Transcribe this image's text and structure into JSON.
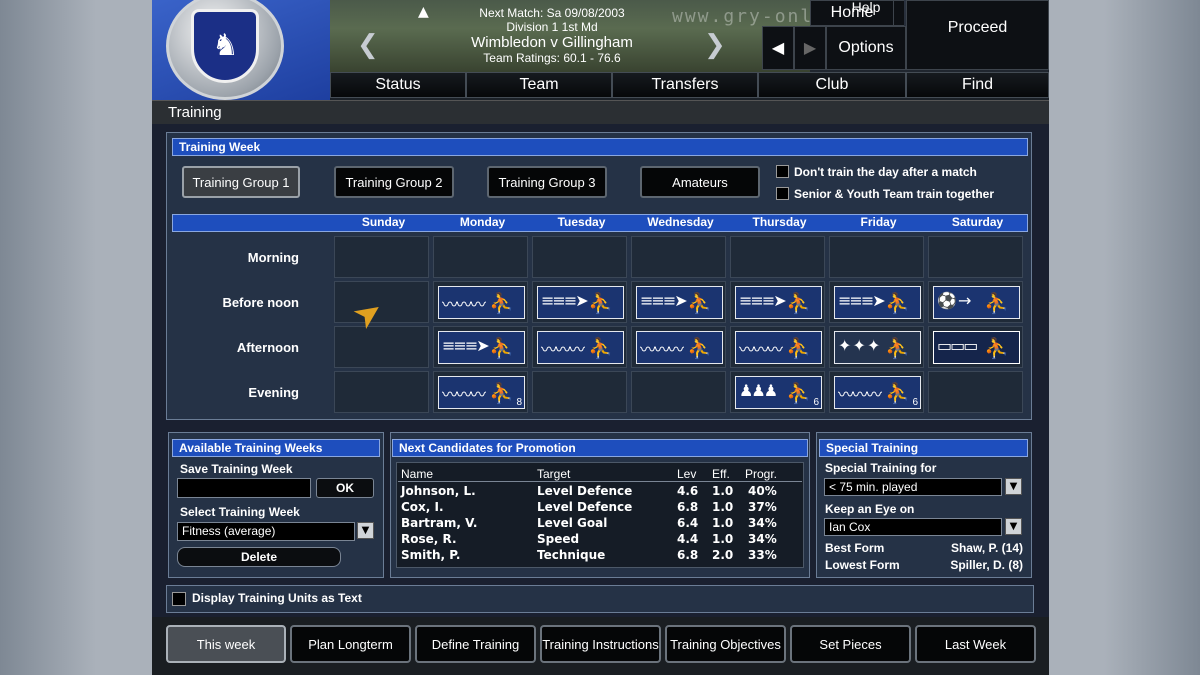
{
  "header": {
    "next_match": "Next Match: Sa 09/08/2003",
    "competition": "Division 1 1st Md",
    "fixture": "Wimbledon v Gillingham",
    "ratings": "Team Ratings: 60.1 - 76.6",
    "watermark": "www.gry-online.pl",
    "home": "Home",
    "help": "Help",
    "proceed": "Proceed",
    "options": "Options",
    "back_icon": "◀",
    "forward_icon": "▶",
    "prev_icon": "❮",
    "next_icon": "❯",
    "up_icon": "▲"
  },
  "nav_tabs": [
    "Status",
    "Team",
    "Transfers",
    "Club",
    "Find"
  ],
  "page_title": "Training",
  "training_week": {
    "title": "Training Week",
    "groups": [
      "Training Group 1",
      "Training Group 2",
      "Training Group 3",
      "Amateurs"
    ],
    "active_group": "Training Group 1",
    "options": [
      "Don't train the day after a match",
      "Senior & Youth Team train together"
    ],
    "days": [
      "Sunday",
      "Monday",
      "Tuesday",
      "Wednesday",
      "Thursday",
      "Friday",
      "Saturday"
    ],
    "slots": [
      "Morning",
      "Before noon",
      "Afternoon",
      "Evening"
    ],
    "grid": [
      [
        "",
        "",
        "",
        "",
        "",
        "",
        ""
      ],
      [
        "",
        "wave",
        "sprint",
        "sprint",
        "sprint",
        "sprint",
        "pass"
      ],
      [
        "",
        "sprint",
        "wave",
        "wave",
        "wave",
        "field",
        "box"
      ],
      [
        "",
        "wave",
        "",
        "",
        "group",
        "wave",
        ""
      ]
    ],
    "grid_numbers": [
      [
        "",
        "",
        "",
        "",
        "",
        "",
        ""
      ],
      [
        "",
        "",
        "",
        "",
        "",
        "",
        ""
      ],
      [
        "",
        "",
        "",
        "",
        "",
        "",
        ""
      ],
      [
        "",
        "8",
        "",
        "",
        "6",
        "6",
        ""
      ]
    ]
  },
  "available_weeks": {
    "title": "Available Training Weeks",
    "save_label": "Save Training Week",
    "save_value": "",
    "ok_label": "OK",
    "select_label": "Select Training Week",
    "select_value": "Fitness (average)",
    "delete_label": "Delete"
  },
  "promotion": {
    "title": "Next Candidates for Promotion",
    "columns": [
      "Name",
      "Target",
      "Lev",
      "Eff.",
      "Progr."
    ],
    "rows": [
      [
        "Johnson, L.",
        "Level Defence",
        "4.6",
        "1.0",
        "40%"
      ],
      [
        "Cox, I.",
        "Level Defence",
        "6.8",
        "1.0",
        "37%"
      ],
      [
        "Bartram, V.",
        "Level Goal",
        "6.4",
        "1.0",
        "34%"
      ],
      [
        "Rose, R.",
        "Speed",
        "4.4",
        "1.0",
        "34%"
      ],
      [
        "Smith, P.",
        "Technique",
        "6.8",
        "2.0",
        "33%"
      ]
    ]
  },
  "special": {
    "title": "Special Training",
    "for_label": "Special Training for",
    "for_value": "< 75 min. played",
    "eye_label": "Keep an Eye on",
    "eye_value": "Ian Cox",
    "best_label": "Best Form",
    "best_value": "Shaw, P. (14)",
    "lowest_label": "Lowest Form",
    "lowest_value": "Spiller, D. (8)"
  },
  "display_text_label": "Display Training Units as Text",
  "bottom_tabs": [
    "This week",
    "Plan Longterm",
    "Define Training",
    "Training Instructions",
    "Training Objectives",
    "Set Pieces",
    "Last Week"
  ],
  "active_bottom_tab": "This week"
}
